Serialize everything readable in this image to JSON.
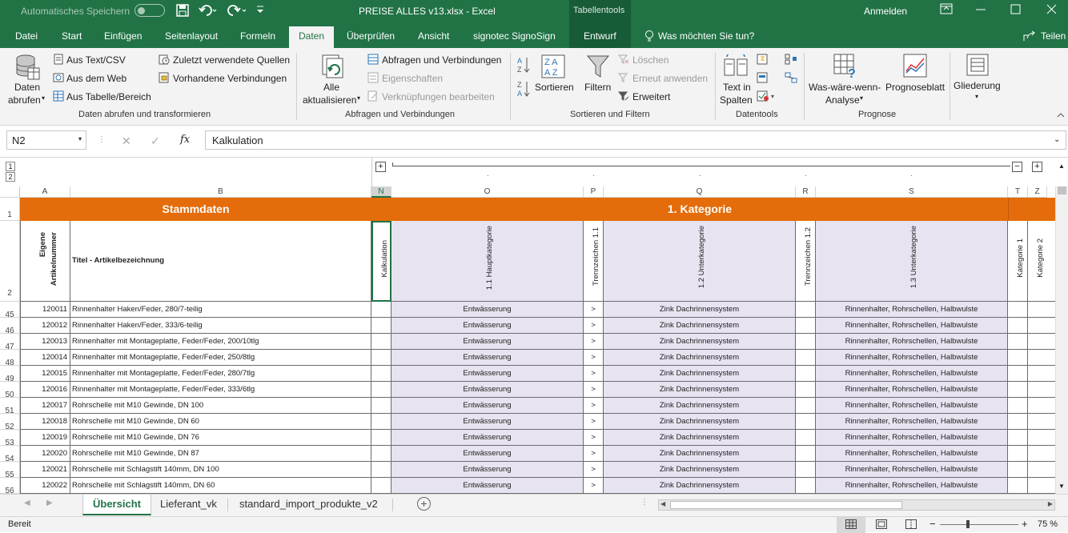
{
  "titlebar": {
    "autosave_label": "Automatisches Speichern",
    "title": "PREISE ALLES v13.xlsx  -  Excel",
    "context_tools": "Tabellentools",
    "signin": "Anmelden"
  },
  "tabs": [
    {
      "label": "Datei"
    },
    {
      "label": "Start"
    },
    {
      "label": "Einfügen"
    },
    {
      "label": "Seitenlayout"
    },
    {
      "label": "Formeln"
    },
    {
      "label": "Daten"
    },
    {
      "label": "Überprüfen"
    },
    {
      "label": "Ansicht"
    },
    {
      "label": "signotec SignoSign"
    },
    {
      "label": "Entwurf"
    }
  ],
  "tellme": "Was möchten Sie tun?",
  "share": "Teilen",
  "ribbon": {
    "get_data": [
      "Daten",
      "abrufen"
    ],
    "from_text": "Aus Text/CSV",
    "from_web": "Aus dem Web",
    "from_table": "Aus Tabelle/Bereich",
    "recent_sources": "Zuletzt verwendete Quellen",
    "existing_conn": "Vorhandene Verbindungen",
    "group1": "Daten abrufen und transformieren",
    "refresh_all": [
      "Alle",
      "aktualisieren"
    ],
    "queries_conn": "Abfragen und Verbindungen",
    "properties": "Eigenschaften",
    "edit_links": "Verknüpfungen bearbeiten",
    "group2": "Abfragen und Verbindungen",
    "sort": "Sortieren",
    "filter": "Filtern",
    "clear": "Löschen",
    "reapply": "Erneut anwenden",
    "advanced": "Erweitert",
    "group3": "Sortieren und Filtern",
    "text_to_cols": [
      "Text in",
      "Spalten"
    ],
    "group4": "Datentools",
    "whatif": [
      "Was-wäre-wenn-",
      "Analyse"
    ],
    "forecast_sheet": "Prognoseblatt",
    "group5": "Prognose",
    "outline": "Gliederung"
  },
  "formula": {
    "cell_ref": "N2",
    "fx": "fx",
    "value": "Kalkulation"
  },
  "outline_levels": [
    "1",
    "2"
  ],
  "columns": [
    "A",
    "B",
    "N",
    "O",
    "P",
    "Q",
    "R",
    "S",
    "T",
    "Z"
  ],
  "row1": {
    "num": "1",
    "stammdaten": "Stammdaten",
    "kategorie": "1. Kategorie"
  },
  "row2": {
    "num": "2",
    "a": [
      "Eigene",
      "Artikelnummer"
    ],
    "b": "Titel - Artikelbezeichnung",
    "n": "Kalkulation",
    "o": "1.1 Hauptkategorie",
    "p": "Trennzeichen 1.1",
    "q": "1.2 Unterkategorie",
    "r": "Trennzeichen 1.2",
    "s": "1.3 Unterkategorie",
    "t": "Kategorie 1",
    "z": "Kategorie 2"
  },
  "rows": [
    {
      "num": "45",
      "art": "120011",
      "title": "Rinnenhalter Haken/Feder, 280/7-teilig",
      "o": "Entwässerung",
      "p": ">",
      "q": "Zink Dachrinnensystem",
      "s": "Rinnenhalter, Rohrschellen, Halbwulste"
    },
    {
      "num": "46",
      "art": "120012",
      "title": "Rinnenhalter Haken/Feder, 333/6-teilig",
      "o": "Entwässerung",
      "p": ">",
      "q": "Zink Dachrinnensystem",
      "s": "Rinnenhalter, Rohrschellen, Halbwulste"
    },
    {
      "num": "47",
      "art": "120013",
      "title": "Rinnenhalter mit Montageplatte, Feder/Feder, 200/10tlg",
      "o": "Entwässerung",
      "p": ">",
      "q": "Zink Dachrinnensystem",
      "s": "Rinnenhalter, Rohrschellen, Halbwulste"
    },
    {
      "num": "48",
      "art": "120014",
      "title": "Rinnenhalter mit Montageplatte, Feder/Feder, 250/8tlg",
      "o": "Entwässerung",
      "p": ">",
      "q": "Zink Dachrinnensystem",
      "s": "Rinnenhalter, Rohrschellen, Halbwulste"
    },
    {
      "num": "49",
      "art": "120015",
      "title": "Rinnenhalter mit Montageplatte, Feder/Feder, 280/7tlg",
      "o": "Entwässerung",
      "p": ">",
      "q": "Zink Dachrinnensystem",
      "s": "Rinnenhalter, Rohrschellen, Halbwulste"
    },
    {
      "num": "50",
      "art": "120016",
      "title": "Rinnenhalter mit Montageplatte, Feder/Feder, 333/6tlg",
      "o": "Entwässerung",
      "p": ">",
      "q": "Zink Dachrinnensystem",
      "s": "Rinnenhalter, Rohrschellen, Halbwulste"
    },
    {
      "num": "51",
      "art": "120017",
      "title": "Rohrschelle mit M10 Gewinde, DN 100",
      "o": "Entwässerung",
      "p": ">",
      "q": "Zink Dachrinnensystem",
      "s": "Rinnenhalter, Rohrschellen, Halbwulste"
    },
    {
      "num": "52",
      "art": "120018",
      "title": "Rohrschelle mit M10 Gewinde, DN 60",
      "o": "Entwässerung",
      "p": ">",
      "q": "Zink Dachrinnensystem",
      "s": "Rinnenhalter, Rohrschellen, Halbwulste"
    },
    {
      "num": "53",
      "art": "120019",
      "title": "Rohrschelle mit M10 Gewinde, DN 76",
      "o": "Entwässerung",
      "p": ">",
      "q": "Zink Dachrinnensystem",
      "s": "Rinnenhalter, Rohrschellen, Halbwulste"
    },
    {
      "num": "54",
      "art": "120020",
      "title": "Rohrschelle mit M10 Gewinde, DN 87",
      "o": "Entwässerung",
      "p": ">",
      "q": "Zink Dachrinnensystem",
      "s": "Rinnenhalter, Rohrschellen, Halbwulste"
    },
    {
      "num": "55",
      "art": "120021",
      "title": "Rohrschelle mit Schlagstift 140mm, DN 100",
      "o": "Entwässerung",
      "p": ">",
      "q": "Zink Dachrinnensystem",
      "s": "Rinnenhalter, Rohrschellen, Halbwulste"
    },
    {
      "num": "56",
      "art": "120022",
      "title": "Rohrschelle mit Schlagstift 140mm, DN 60",
      "o": "Entwässerung",
      "p": ">",
      "q": "Zink Dachrinnensystem",
      "s": "Rinnenhalter, Rohrschellen, Halbwulste"
    }
  ],
  "sheets": [
    {
      "label": "Übersicht"
    },
    {
      "label": "Lieferant_vk"
    },
    {
      "label": "standard_import_produkte_v2"
    }
  ],
  "status": {
    "ready": "Bereit",
    "zoom": "75 %"
  },
  "colors": {
    "excel_green": "#217346",
    "header_orange": "#e46c0a",
    "lavender": "#e7e3f0"
  }
}
